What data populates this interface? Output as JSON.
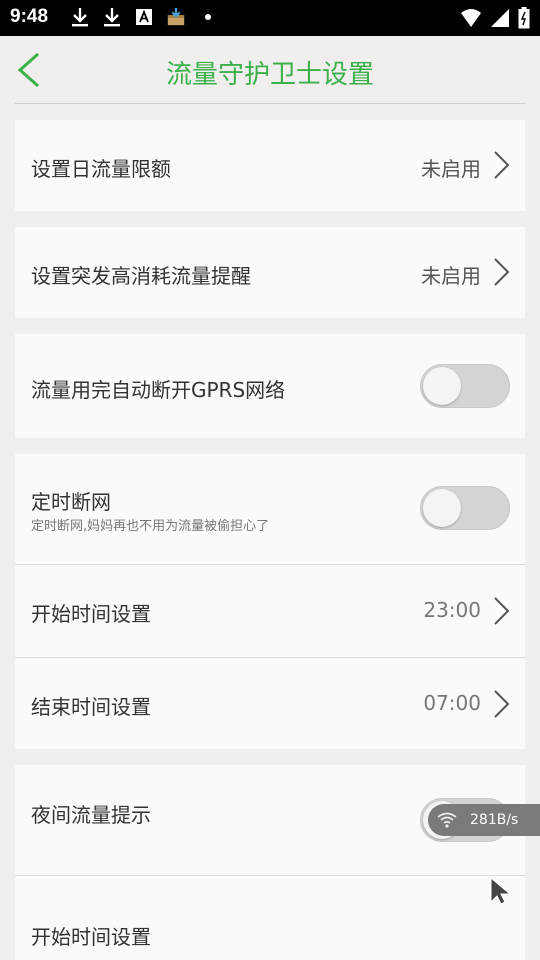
{
  "status_bar": {
    "time": "9:48",
    "notification_icons": [
      "download-icon",
      "download-icon",
      "a-box-icon",
      "package-download-icon",
      "dot-icon"
    ],
    "system_icons": [
      "wifi-icon",
      "signal-icon",
      "battery-icon"
    ]
  },
  "header": {
    "title": "流量守护卫士设置",
    "accent_color": "#3cb04a"
  },
  "settings": {
    "daily_limit": {
      "label": "设置日流量限额",
      "value": "未启用"
    },
    "burst_alert": {
      "label": "设置突发高消耗流量提醒",
      "value": "未启用"
    },
    "auto_disconnect": {
      "label": "流量用完自动断开GPRS网络",
      "enabled": false
    },
    "scheduled_disconnect": {
      "label": "定时断网",
      "sublabel": "定时断网,妈妈再也不用为流量被偷担心了",
      "enabled": false,
      "start": {
        "label": "开始时间设置",
        "value": "23:00"
      },
      "end": {
        "label": "结束时间设置",
        "value": "07:00"
      }
    },
    "night_alert": {
      "label": "夜间流量提示",
      "enabled": false,
      "start": {
        "label": "开始时间设置"
      }
    }
  },
  "speed_overlay": {
    "text": "281B/s"
  }
}
